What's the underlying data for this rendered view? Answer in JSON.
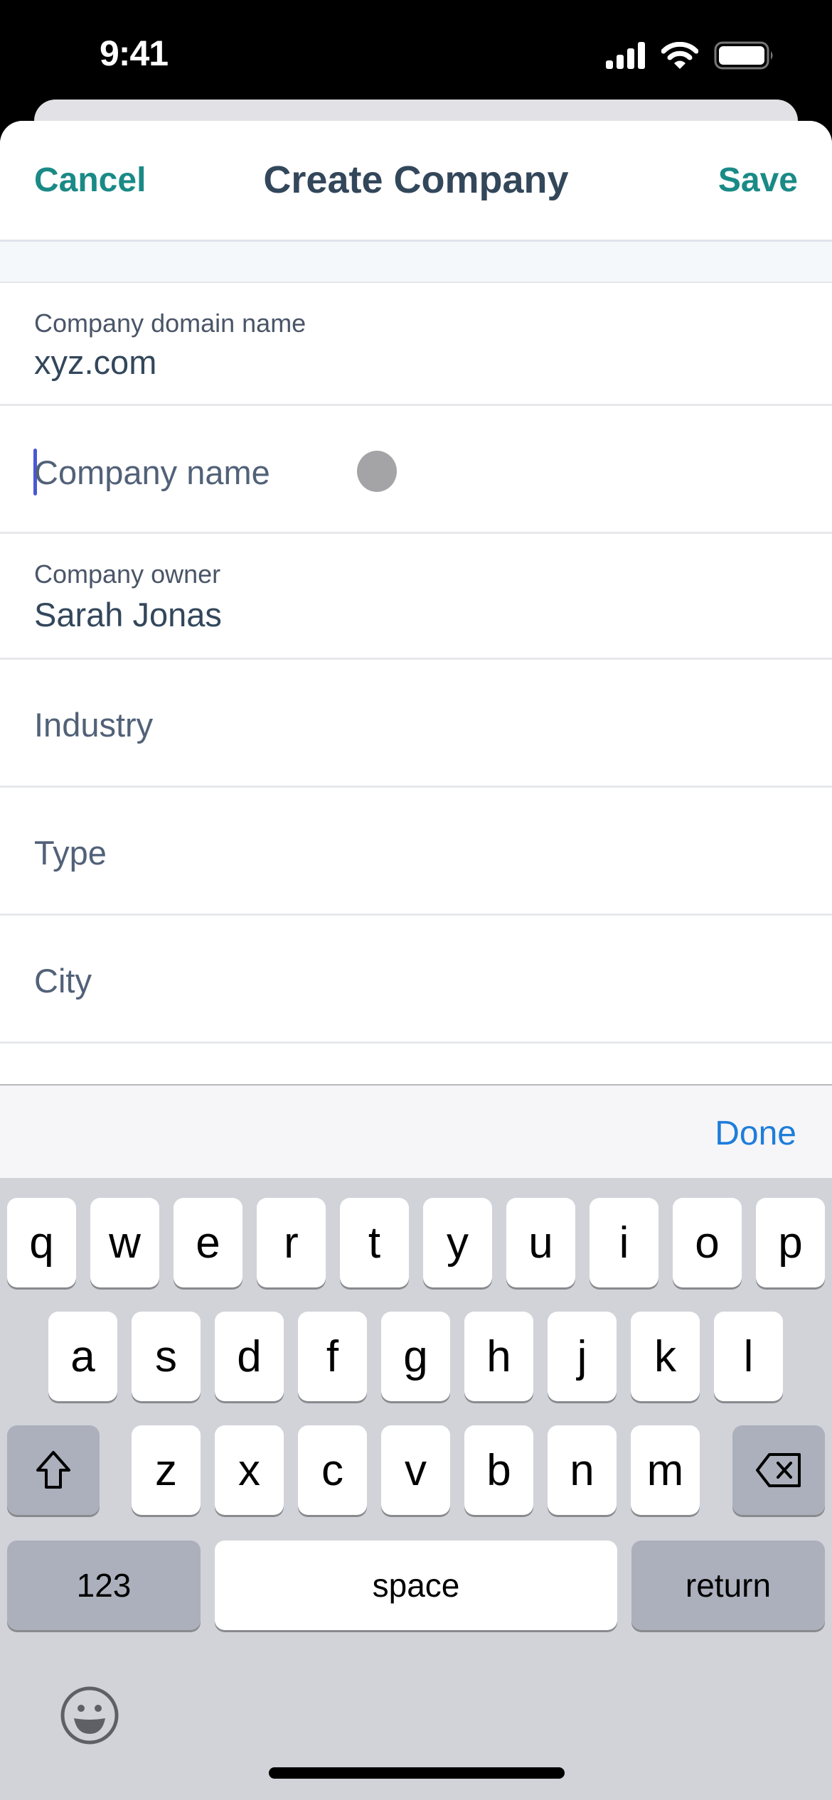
{
  "status_bar": {
    "time": "9:41",
    "icons": [
      "signal-icon",
      "wifi-icon",
      "battery-icon"
    ]
  },
  "header": {
    "cancel_label": "Cancel",
    "title": "Create Company",
    "save_label": "Save"
  },
  "form": {
    "domain": {
      "label": "Company domain name",
      "value": "xyz.com"
    },
    "company_name": {
      "placeholder": "Company name",
      "value": ""
    },
    "owner": {
      "label": "Company owner",
      "value": "Sarah Jonas"
    },
    "industry": {
      "placeholder": "Industry"
    },
    "type": {
      "placeholder": "Type"
    },
    "city": {
      "placeholder": "City"
    }
  },
  "accessory": {
    "done_label": "Done"
  },
  "keyboard": {
    "row1": [
      "q",
      "w",
      "e",
      "r",
      "t",
      "y",
      "u",
      "i",
      "o",
      "p"
    ],
    "row2": [
      "a",
      "s",
      "d",
      "f",
      "g",
      "h",
      "j",
      "k",
      "l"
    ],
    "row3": [
      "z",
      "x",
      "c",
      "v",
      "b",
      "n",
      "m"
    ],
    "numbers_label": "123",
    "space_label": "space",
    "return_label": "return"
  },
  "colors": {
    "accent_teal": "#1a8a86",
    "done_blue": "#1e7ddb",
    "cursor": "#4a57d6",
    "text_dark": "#33475b"
  }
}
